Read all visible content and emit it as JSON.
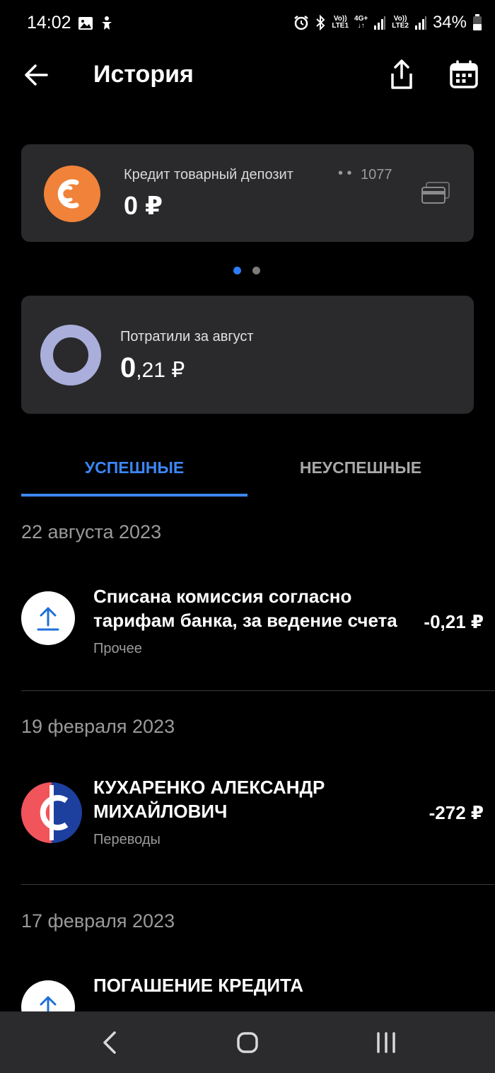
{
  "status_bar": {
    "time": "14:02",
    "battery": "34%",
    "sim1_top": "Vo))",
    "sim1_bottom": "LTE1",
    "net_top": "4G+",
    "sim2_top": "Vo))",
    "sim2_bottom": "LTE2"
  },
  "header": {
    "title": "История"
  },
  "account": {
    "name": "Кредит товарный депозит",
    "number_dots": "• •",
    "number": "1077",
    "balance": "0 ₽",
    "logo_color": "#f0823a"
  },
  "spending": {
    "label": "Потратили за август",
    "value_int": "0",
    "value_frac": ",21 ₽",
    "ring_color": "#a9aedb"
  },
  "tabs": {
    "success": "УСПЕШНЫЕ",
    "failed": "НЕУСПЕШНЫЕ"
  },
  "history": [
    {
      "date": "22 августа 2023",
      "title_line1": "Списана комиссия согласно",
      "title_line2": "тарифам банка, за ведение счета",
      "category": "Прочее",
      "amount": "-0,21 ₽"
    },
    {
      "date": "19 февраля 2023",
      "title_line1": "КУХАРЕНКО АЛЕКСАНДР",
      "title_line2": "МИХАЙЛОВИЧ",
      "category": "Переводы",
      "amount": "-272 ₽"
    },
    {
      "date": "17 февраля 2023",
      "title_line1": "ПОГАШЕНИЕ КРЕДИТА"
    }
  ],
  "colors": {
    "accent": "#3c86f5",
    "card_bg": "#2a2a2c",
    "sbp_red": "#f2545b",
    "sbp_blue": "#1d3f9e"
  }
}
